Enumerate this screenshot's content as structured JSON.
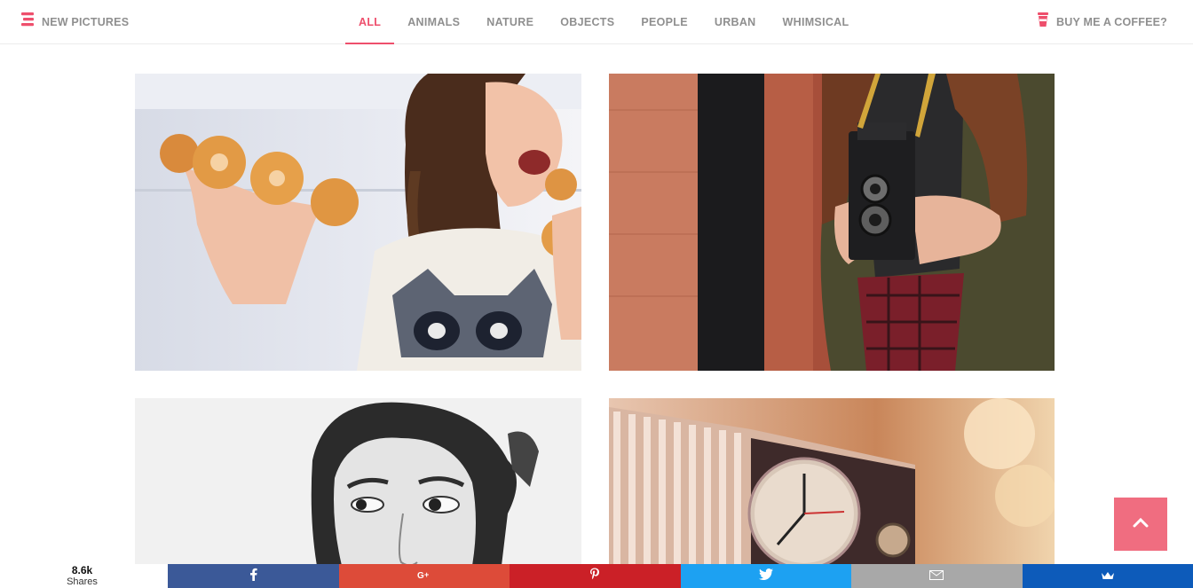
{
  "header": {
    "brand_label": "NEW PICTURES",
    "nav": [
      {
        "label": "ALL",
        "active": true
      },
      {
        "label": "ANIMALS",
        "active": false
      },
      {
        "label": "NATURE",
        "active": false
      },
      {
        "label": "OBJECTS",
        "active": false
      },
      {
        "label": "PEOPLE",
        "active": false
      },
      {
        "label": "URBAN",
        "active": false
      },
      {
        "label": "WHIMSICAL",
        "active": false
      }
    ],
    "coffee_label": "BUY ME A COFFEE?"
  },
  "share": {
    "count": "8.6k",
    "count_label": "Shares",
    "buttons": [
      {
        "network": "facebook",
        "icon": "facebook-icon",
        "color": "#3b5998"
      },
      {
        "network": "google-plus",
        "icon": "google-plus-icon",
        "color": "#dd4b39"
      },
      {
        "network": "pinterest",
        "icon": "pinterest-icon",
        "color": "#cb2027"
      },
      {
        "network": "twitter",
        "icon": "twitter-icon",
        "color": "#1da1f2"
      },
      {
        "network": "email",
        "icon": "email-icon",
        "color": "#a8a8a8"
      },
      {
        "network": "sumome",
        "icon": "crown-icon",
        "color": "#0d5bba"
      }
    ]
  },
  "back_to_top": {
    "icon": "chevron-up-icon"
  },
  "colors": {
    "accent": "#ee4f6c",
    "nav_text": "#8f8f8f",
    "back_to_top": "#f06d80"
  }
}
